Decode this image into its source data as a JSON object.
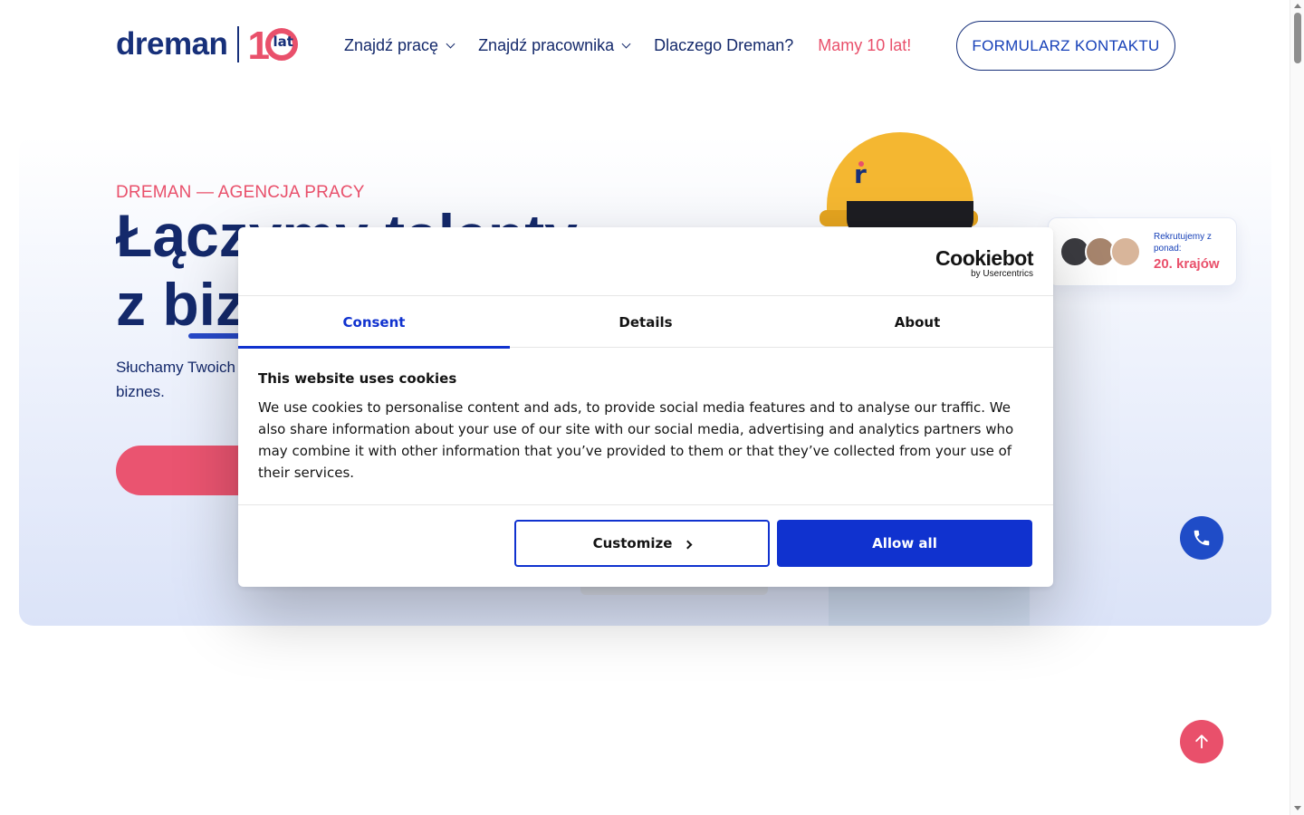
{
  "header": {
    "logo_text": "dreman",
    "logo_ten": "1",
    "logo_lat": "lat",
    "nav": [
      {
        "label": "Znajdź pracę"
      },
      {
        "label": "Znajdź pracownika"
      },
      {
        "label": "Dlaczego Dreman?"
      },
      {
        "label": "Mamy 10 lat!"
      }
    ],
    "contact_label": "FORMULARZ KONTAKTU"
  },
  "hero": {
    "eyebrow": "DREMAN — AGENCJA PRACY",
    "headline_line1": "Łączymy talenty",
    "headline_line2": "z biznesem",
    "lead": "Słuchamy Twoich potrzeb i rozumiemy wyzwania. Wspieramy Twój biznes.",
    "badge_small": "Rekrutujemy z ponad:",
    "badge_big": "20. krajów"
  },
  "cookie": {
    "brand": "Cookiebot",
    "brand_sub": "by Usercentrics",
    "tabs": [
      {
        "label": "Consent"
      },
      {
        "label": "Details"
      },
      {
        "label": "About"
      }
    ],
    "title": "This website uses cookies",
    "text": "We use cookies to personalise content and ads, to provide social media features and to analyse our traffic. We also share information about your use of our site with our social media, advertising and analytics partners who may combine it with other information that you’ve provided to them or that they’ve collected from your use of their services.",
    "customize_label": "Customize",
    "allow_label": "Allow all"
  },
  "colors": {
    "brand_navy": "#14296b",
    "brand_pink": "#e9506b",
    "cookiebot_blue": "#1032cf"
  }
}
